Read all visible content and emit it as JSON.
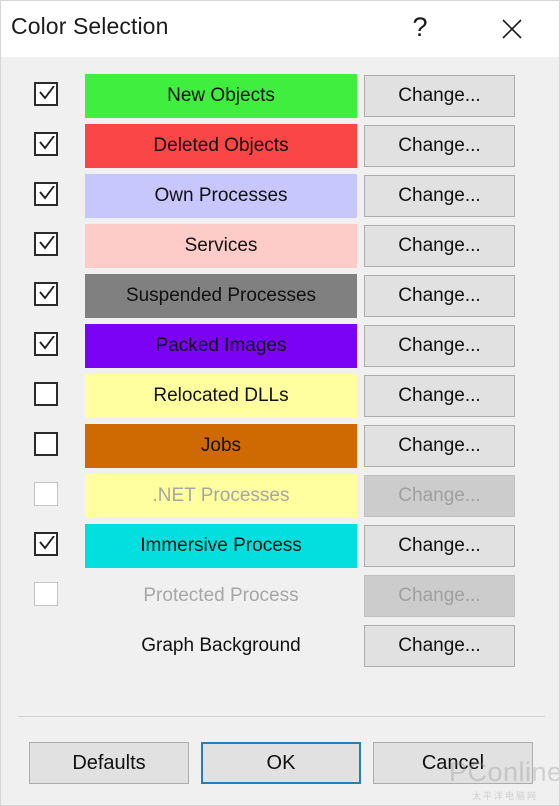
{
  "window": {
    "title": "Color Selection",
    "help_label": "?",
    "help_icon": "question-mark-icon",
    "close_icon": "close-x-icon",
    "background_color": "#f0f0f0",
    "titlebar_color": "#ffffff"
  },
  "rows": [
    {
      "label": "New Objects",
      "color": "#3fee3f",
      "checked": true,
      "enabled": true,
      "has_checkbox": true,
      "has_swatch": true,
      "button_label": "Change...",
      "button_enabled": true
    },
    {
      "label": "Deleted Objects",
      "color": "#fa4646",
      "checked": true,
      "enabled": true,
      "has_checkbox": true,
      "has_swatch": true,
      "button_label": "Change...",
      "button_enabled": true
    },
    {
      "label": "Own Processes",
      "color": "#c7c7fd",
      "checked": true,
      "enabled": true,
      "has_checkbox": true,
      "has_swatch": true,
      "button_label": "Change...",
      "button_enabled": true
    },
    {
      "label": "Services",
      "color": "#fdccc8",
      "checked": true,
      "enabled": true,
      "has_checkbox": true,
      "has_swatch": true,
      "button_label": "Change...",
      "button_enabled": true
    },
    {
      "label": "Suspended Processes",
      "color": "#808080",
      "checked": true,
      "enabled": true,
      "has_checkbox": true,
      "has_swatch": true,
      "button_label": "Change...",
      "button_enabled": true
    },
    {
      "label": "Packed Images",
      "color": "#7b02f5",
      "checked": true,
      "enabled": true,
      "has_checkbox": true,
      "has_swatch": true,
      "button_label": "Change...",
      "button_enabled": true
    },
    {
      "label": "Relocated DLLs",
      "color": "#ffffa0",
      "checked": false,
      "enabled": true,
      "has_checkbox": true,
      "has_swatch": true,
      "button_label": "Change...",
      "button_enabled": true
    },
    {
      "label": "Jobs",
      "color": "#cf6a03",
      "checked": false,
      "enabled": true,
      "has_checkbox": true,
      "has_swatch": true,
      "button_label": "Change...",
      "button_enabled": true
    },
    {
      "label": ".NET Processes",
      "color": "#ffffa0",
      "checked": false,
      "enabled": false,
      "has_checkbox": true,
      "has_swatch": true,
      "button_label": "Change...",
      "button_enabled": false
    },
    {
      "label": "Immersive Process",
      "color": "#03dede",
      "checked": true,
      "enabled": true,
      "has_checkbox": true,
      "has_swatch": true,
      "button_label": "Change...",
      "button_enabled": true
    },
    {
      "label": "Protected Process",
      "color": "#f0f0f0",
      "checked": false,
      "enabled": false,
      "has_checkbox": true,
      "has_swatch": false,
      "button_label": "Change...",
      "button_enabled": false
    },
    {
      "label": "Graph Background",
      "color": "#f0f0f0",
      "checked": false,
      "enabled": true,
      "has_checkbox": false,
      "has_swatch": false,
      "button_label": "Change...",
      "button_enabled": true
    }
  ],
  "footer": {
    "defaults_label": "Defaults",
    "ok_label": "OK",
    "cancel_label": "Cancel",
    "focus_color": "#2680b8"
  },
  "watermark": {
    "main": "PConline",
    "sub": "太平洋电脑网"
  }
}
